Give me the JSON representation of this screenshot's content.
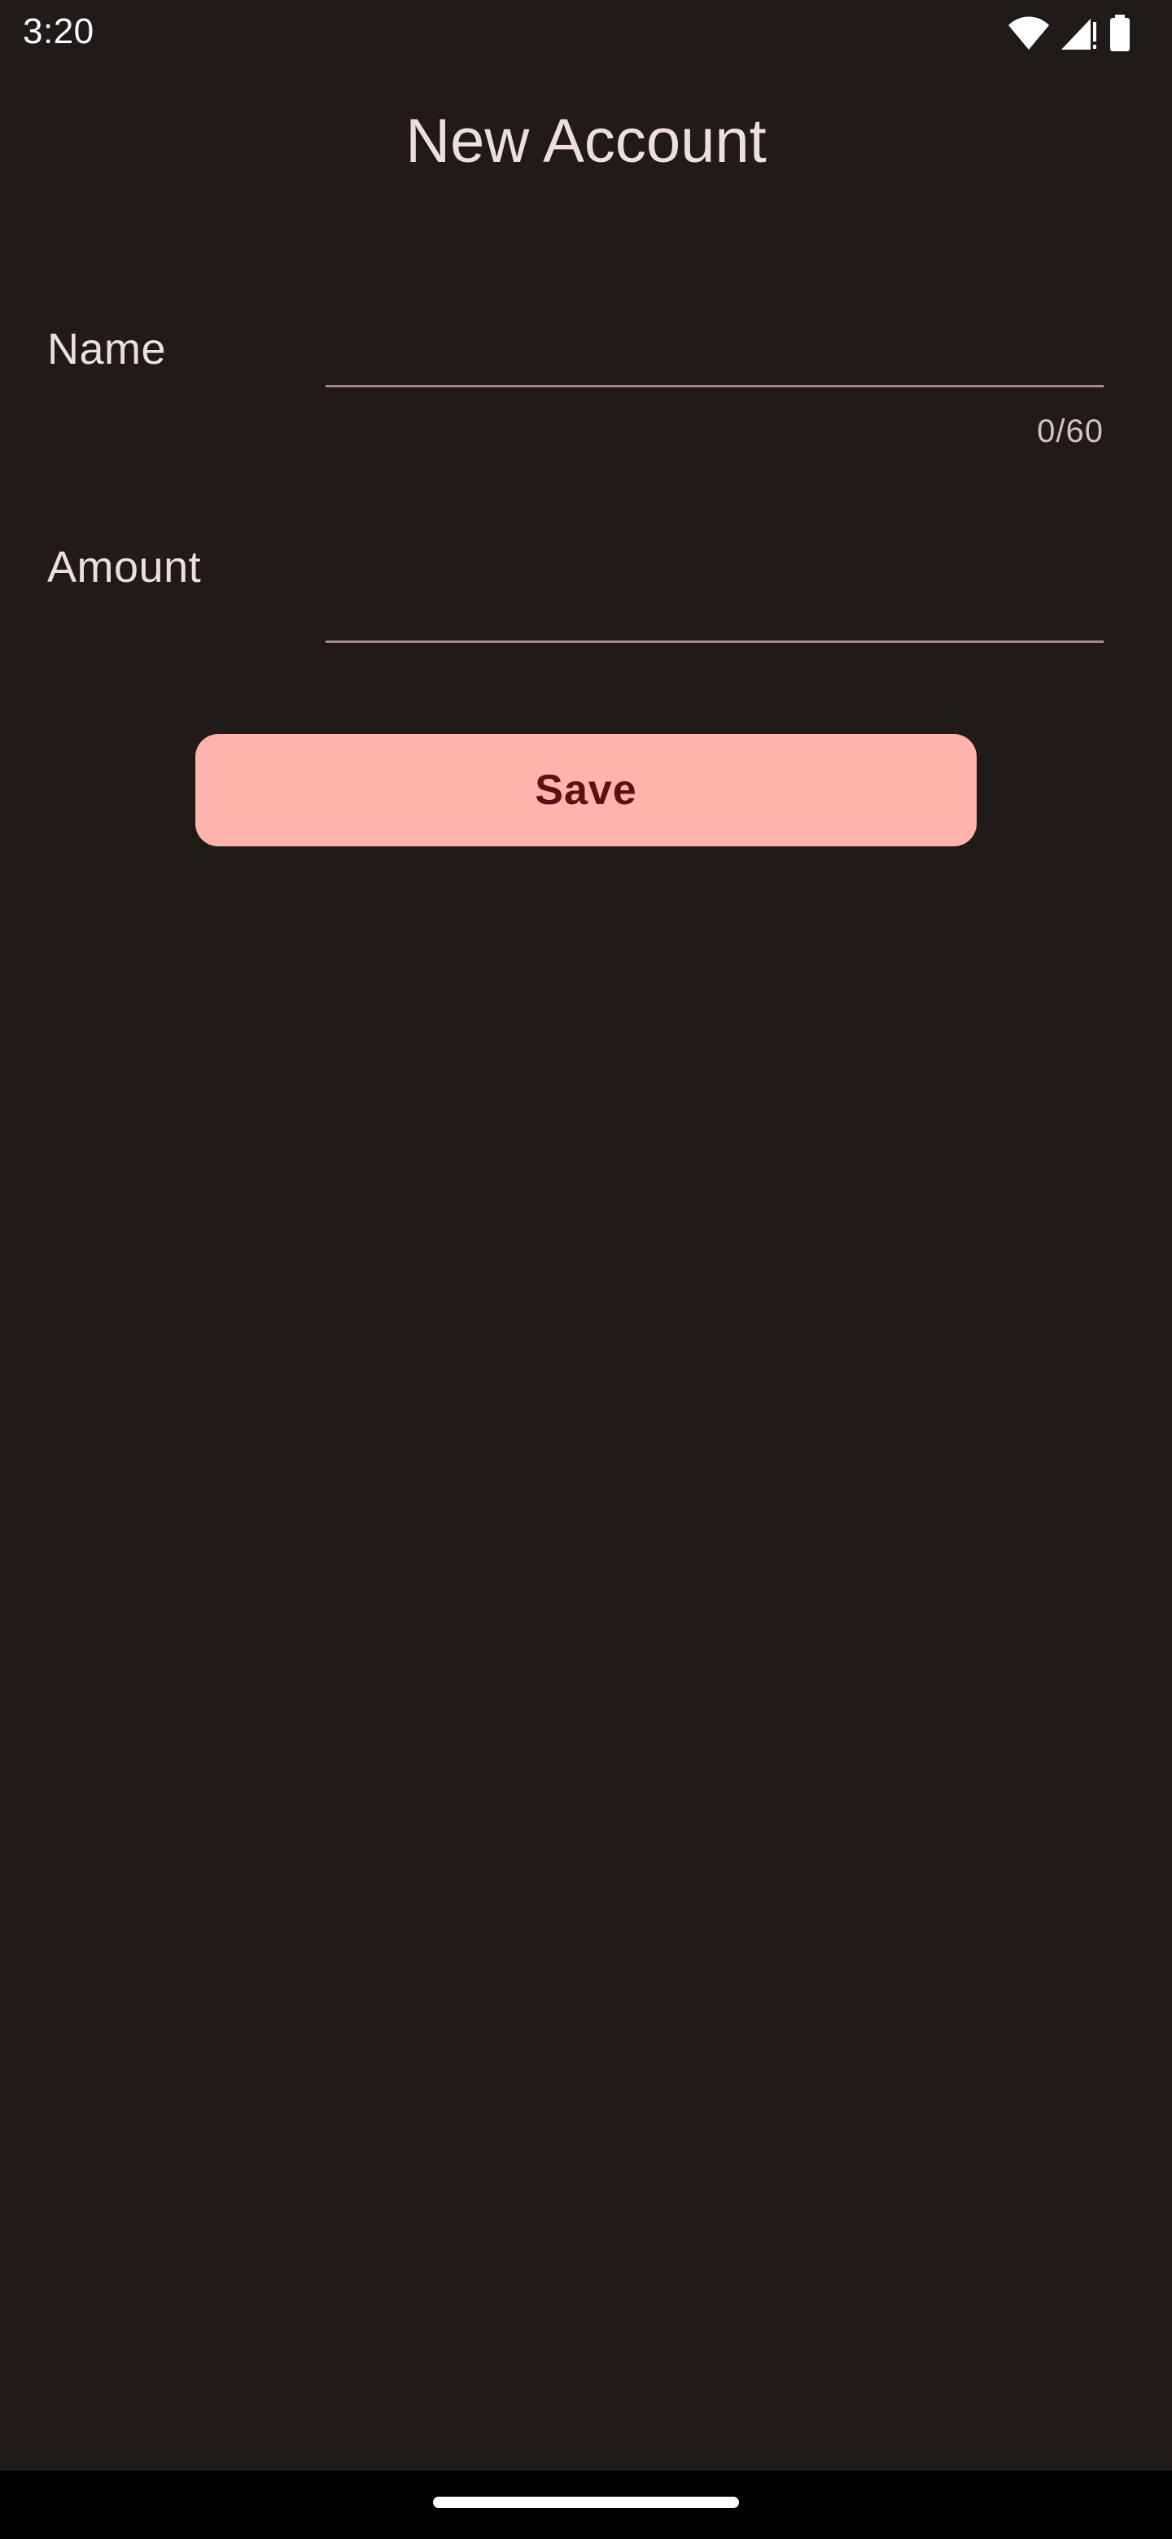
{
  "status_bar": {
    "time": "3:20",
    "icons": [
      "wifi-icon",
      "cellular-signal-icon",
      "battery-icon"
    ]
  },
  "page": {
    "title": "New Account"
  },
  "form": {
    "name": {
      "label": "Name",
      "value": "",
      "counter": "0/60"
    },
    "amount": {
      "label": "Amount",
      "value": ""
    },
    "save_label": "Save"
  },
  "colors": {
    "background": "#201a18",
    "on_surface": "#ede0dc",
    "primary_button": "#ffb4ab",
    "on_primary_button": "#5c1111",
    "underline": "#a08c89"
  },
  "nav_bar": {
    "home_indicator": "home-indicator"
  }
}
